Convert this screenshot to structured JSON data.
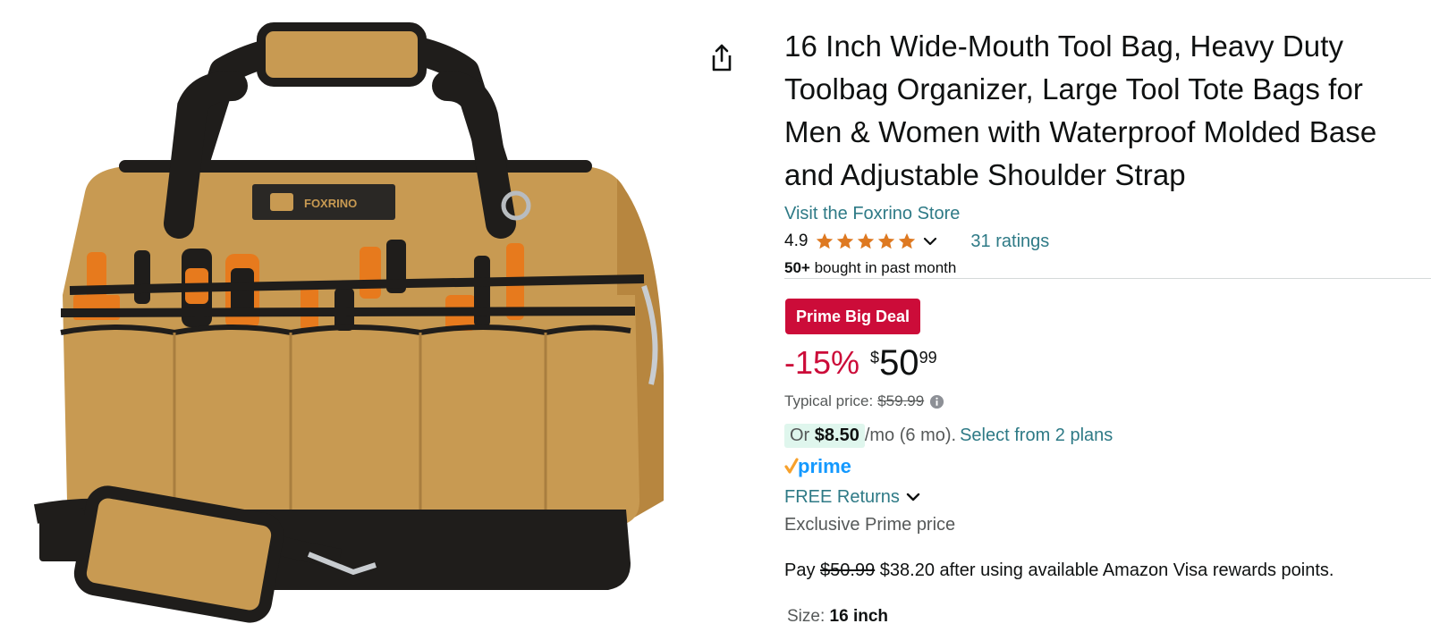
{
  "product": {
    "image_alt": "FOXRINO tool bag",
    "image_brand_text": "FOXRINO",
    "title": "16 Inch Wide-Mouth Tool Bag, Heavy Duty Toolbag Organizer, Large Tool Tote Bags for Men & Women with Waterproof Molded Base and Adjustable Shoulder Strap",
    "store_link": "Visit the Foxrino Store",
    "rating": "4.9",
    "ratings_count": "31 ratings",
    "bought_count": "50+",
    "bought_text": "bought in past month"
  },
  "deal": {
    "badge": "Prime Big Deal",
    "discount": "-15%",
    "price_symbol": "$",
    "price_whole": "50",
    "price_fraction": "99",
    "typical_label": "Typical price:",
    "typical_price": "$59.99"
  },
  "installment": {
    "prefix": "Or",
    "amount": "$8.50",
    "term": "/mo (6 mo).",
    "plans_link": "Select from 2 plans"
  },
  "prime": {
    "label": "prime"
  },
  "returns": {
    "label": "FREE Returns"
  },
  "exclusive": "Exclusive Prime price",
  "pay": {
    "prefix": "Pay",
    "original": "$50.99",
    "after": "$38.20 after using available Amazon Visa rewards points."
  },
  "size": {
    "label": "Size:",
    "value": "16 inch"
  },
  "colors": {
    "link": "#2e7a86",
    "deal_red": "#cc0c39",
    "star": "#de7921",
    "prime_blue": "#1399ff",
    "installment_bg": "#dff6ed",
    "bag_tan": "#c89a52",
    "bag_black": "#1f1d1b",
    "tool_orange": "#e77a1d"
  },
  "icons": {
    "share": "share-icon",
    "star": "star-icon",
    "chevron": "chevron-down-icon",
    "info": "info-icon",
    "prime_check": "prime-check-icon"
  }
}
